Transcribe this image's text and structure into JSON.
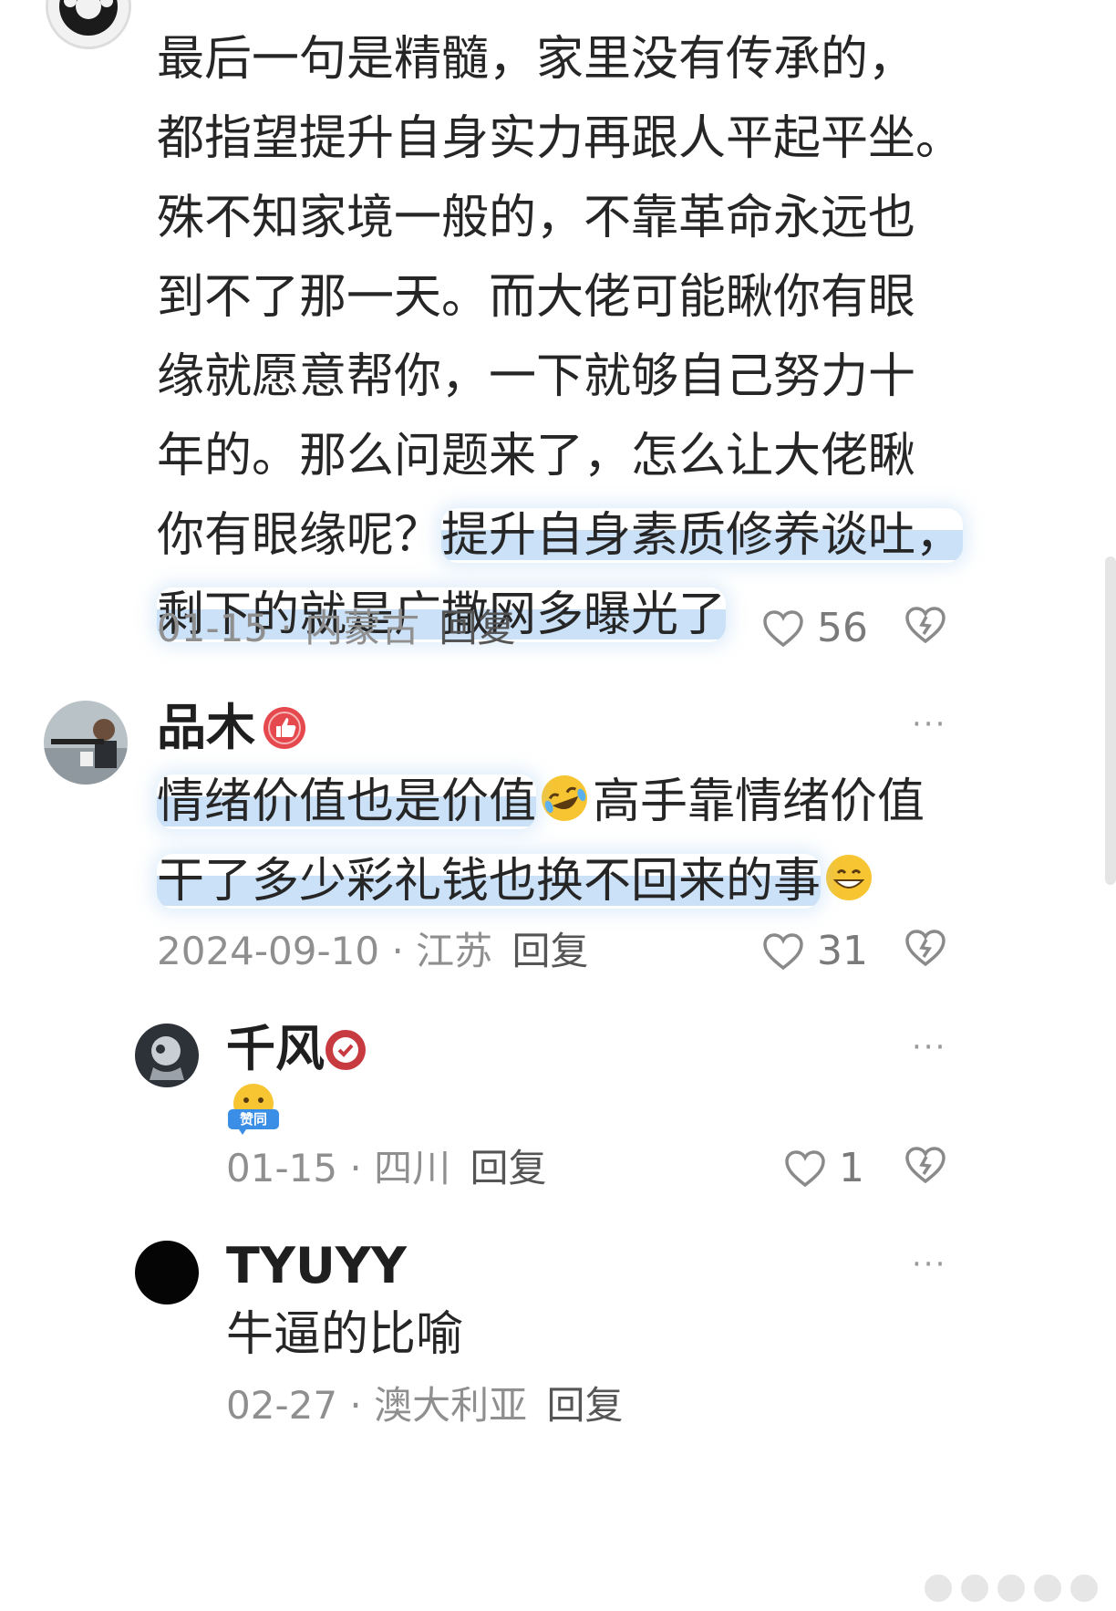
{
  "comments": [
    {
      "id": "c1",
      "lines": [
        "最后一句是精髓，家里没有传承的，",
        "都指望提升自身实力再跟人平起平坐。",
        "殊不知家境一般的，不靠革命永远也",
        "到不了那一天。而大佬可能瞅你有眼",
        "缘就愿意帮你，一下就够自己努力十",
        "年的。那么问题来了，怎么让大佬瞅"
      ],
      "line7_plain": "你有眼缘呢？",
      "line7_highlight": "提升自身素质修养谈吐，",
      "line8_highlight": "剩下的就是广撒网多曝光了",
      "date": "01-15",
      "separator": "·",
      "location": "内蒙古",
      "reply": "回复",
      "likes": "56"
    },
    {
      "id": "c2",
      "name": "品木",
      "badge_icon": "thumbs-up-badge-icon",
      "line1_highlight": "情绪价值也是价值",
      "line1_after": "高手靠情绪价值",
      "line2_highlight": "干了多少彩礼钱也换不回来的事",
      "emoji1": "rolling-laughing-emoji",
      "emoji2": "grinning-emoji",
      "date": "2024-09-10",
      "separator": "·",
      "location": "江苏",
      "reply": "回复",
      "likes": "31",
      "more": "···"
    },
    {
      "id": "c3",
      "name": "千风",
      "badge_icon": "verified-check-badge-icon",
      "sticker_text": "赞同",
      "date": "01-15",
      "separator": "·",
      "location": "四川",
      "reply": "回复",
      "likes": "1",
      "more": "···"
    },
    {
      "id": "c4",
      "name": "TYUYY",
      "text": "牛逼的比喻",
      "date": "02-27",
      "separator": "·",
      "location": "澳大利亚",
      "reply": "回复",
      "more": "···"
    }
  ],
  "colors": {
    "highlight": "#a0c8f0",
    "meta": "#8f8f8f",
    "badge_red": "#e5484d"
  }
}
